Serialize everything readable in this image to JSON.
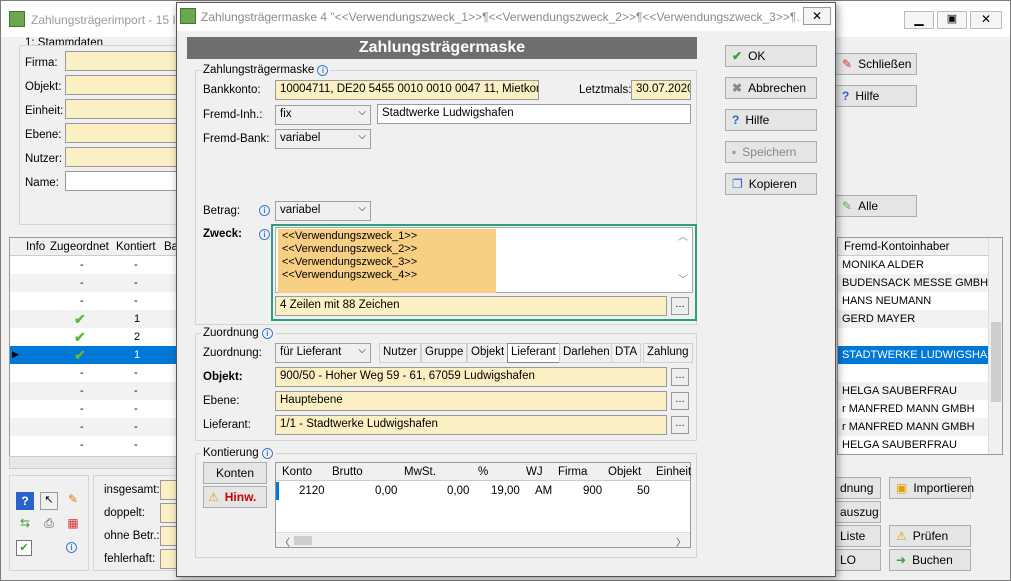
{
  "bg_window": {
    "title": "Zahlungsträgerimport - 15 I",
    "tab_label": "1: Stammdaten",
    "labels": [
      "Firma:",
      "Objekt:",
      "Einheit:",
      "Ebene:",
      "Nutzer:",
      "Name:"
    ],
    "grid_headers": [
      "Info",
      "Zugeordnet",
      "Kontiert",
      "Ba"
    ],
    "grid_rows": [
      {
        "zugeordnet": "-",
        "kontiert": "-"
      },
      {
        "zugeordnet": "-",
        "kontiert": "-"
      },
      {
        "zugeordnet": "-",
        "kontiert": "-"
      },
      {
        "zugeordnet": "check",
        "kontiert": "1"
      },
      {
        "zugeordnet": "check",
        "kontiert": "2"
      },
      {
        "zugeordnet": "check",
        "kontiert": "1"
      },
      {
        "zugeordnet": "-",
        "kontiert": "-"
      },
      {
        "zugeordnet": "-",
        "kontiert": "-"
      },
      {
        "zugeordnet": "-",
        "kontiert": "-"
      },
      {
        "zugeordnet": "-",
        "kontiert": "-"
      },
      {
        "zugeordnet": "-",
        "kontiert": "-"
      }
    ],
    "right_header": "Fremd-Kontoinhaber",
    "right_rows": [
      "MONIKA ALDER",
      "BUDENSACK MESSE GMBH",
      "HANS NEUMANN",
      "GERD MAYER",
      "",
      "STADTWERKE LUDWIGSHA",
      "",
      "HELGA SAUBERFRAU",
      "r MANFRED MANN GMBH",
      "r MANFRED MANN GMBH",
      "HELGA SAUBERFRAU"
    ],
    "buttons": {
      "schliessen": "Schließen",
      "hilfe": "Hilfe",
      "alle": "Alle",
      "ordnung": "dnung",
      "importieren": "Importieren",
      "auszug": "auszug",
      "liste": "Liste",
      "pruefen": "Prüfen",
      "lo": "LO",
      "buchen": "Buchen"
    },
    "stats": [
      "insgesamt:",
      "doppelt:",
      "ohne Betr.:",
      "fehlerhaft:"
    ]
  },
  "dialog": {
    "title": "Zahlungsträgermaske 4 \"<<Verwendungszweck_1>>¶<<Verwendungszweck_2>>¶<<Verwendungszweck_3>>¶...",
    "header": "Zahlungsträgermaske",
    "section1": "Zahlungsträgermaske",
    "bankkonto_label": "Bankkonto:",
    "bankkonto_value": "10004711,  DE20 5455 0010 0010 0047 11,  Mietkonto",
    "letztmals_label": "Letztmals:",
    "letztmals_value": "30.07.2020",
    "fremdinh_label": "Fremd-Inh.:",
    "fremdinh_combo": "fix",
    "fremdinh_value": "Stadtwerke Ludwigshafen",
    "fremdbank_label": "Fremd-Bank:",
    "fremdbank_combo": "variabel",
    "betrag_label": "Betrag:",
    "betrag_combo": "variabel",
    "zweck_label": "Zweck:",
    "zweck_lines": [
      "<<Verwendungszweck_1>>",
      "<<Verwendungszweck_2>>",
      "<<Verwendungszweck_3>>",
      "<<Verwendungszweck_4>>"
    ],
    "zweck_status": "4 Zeilen mit 88 Zeichen",
    "section2": "Zuordnung",
    "zuordnung_label": "Zuordnung:",
    "zuordnung_combo": "für Lieferant",
    "zuordnung_tabs": [
      "Nutzer",
      "Gruppe",
      "Objekt",
      "Lieferant",
      "Darlehen",
      "DTA",
      "Zahlung"
    ],
    "objekt_label": "Objekt:",
    "objekt_value": "900/50 - Hoher Weg 59 - 61, 67059 Ludwigshafen",
    "ebene_label": "Ebene:",
    "ebene_value": "Hauptebene",
    "lieferant_label": "Lieferant:",
    "lieferant_value": "1/1 - Stadtwerke Ludwigshafen",
    "section3": "Kontierung",
    "konten_btn": "Konten",
    "hinw_btn": "Hinw.",
    "kont_headers": [
      "Konto",
      "Brutto",
      "MwSt.",
      "%",
      "WJ",
      "Firma",
      "Objekt",
      "Einheit"
    ],
    "kont_row": [
      "2120",
      "0,00",
      "0,00",
      "19,00",
      "AM",
      "900",
      "50",
      ""
    ],
    "buttons": {
      "ok": "OK",
      "abbrechen": "Abbrechen",
      "hilfe": "Hilfe",
      "speichern": "Speichern",
      "kopieren": "Kopieren"
    }
  },
  "colors": {
    "accent_green": "#2e9e7c",
    "field_yellow": "#fbf0c3",
    "selected_blue": "#0078d7",
    "header_gray": "#6e6e6e"
  }
}
